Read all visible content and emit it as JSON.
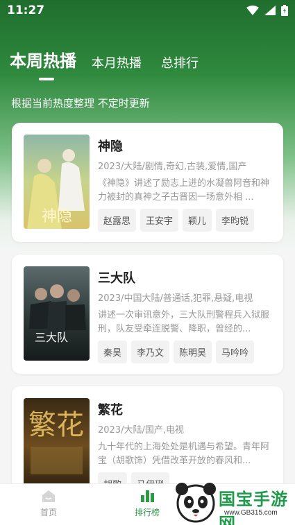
{
  "status_bar": {
    "time": "11:27"
  },
  "tabs": [
    {
      "label": "本周热播",
      "active": true
    },
    {
      "label": "本月热播",
      "active": false
    },
    {
      "label": "总排行",
      "active": false
    }
  ],
  "subtitle": "根据当前热度整理 不定时更新",
  "cards": [
    {
      "title": "神隐",
      "meta": "2023/大陆/剧情,奇幻,古装,爱情,国产",
      "description": "《神隐》讲述了励志上进的水凝兽阿音和神力被封的真神之子古晋因一场意外相 ...",
      "actors": [
        "赵露思",
        "王安宇",
        "颖儿",
        "李昀锐"
      ],
      "poster_text": "神隐"
    },
    {
      "title": "三大队",
      "meta": "2023/中国大陆/普通话,犯罪,悬疑,电视",
      "description": "讲述一次审讯意外，三大队刑警程兵入狱服刑，队友受牵连脱警、降职，曾经的...",
      "actors": [
        "秦昊",
        "李乃文",
        "陈明昊",
        "马吟吟"
      ],
      "poster_text": "三大队"
    },
    {
      "title": "繁花",
      "meta": "2023/大陆/国产,电视",
      "description": "九十年代的上海处处是机遇与希望。青年阿宝（胡歌饰）凭借改革开放的春风和...",
      "actors": [
        "胡歌",
        "马伊琍"
      ],
      "poster_text": "繁花"
    }
  ],
  "bottom_nav": [
    {
      "label": "首页",
      "icon": "home-icon",
      "active": false
    },
    {
      "label": "排行榜",
      "icon": "ranking-icon",
      "active": true
    }
  ],
  "watermark": {
    "text": "国宝手游网",
    "url": "www.GB315.com"
  },
  "colors": {
    "accent": "#2e9a48",
    "header_green": "#1f6d2d"
  }
}
